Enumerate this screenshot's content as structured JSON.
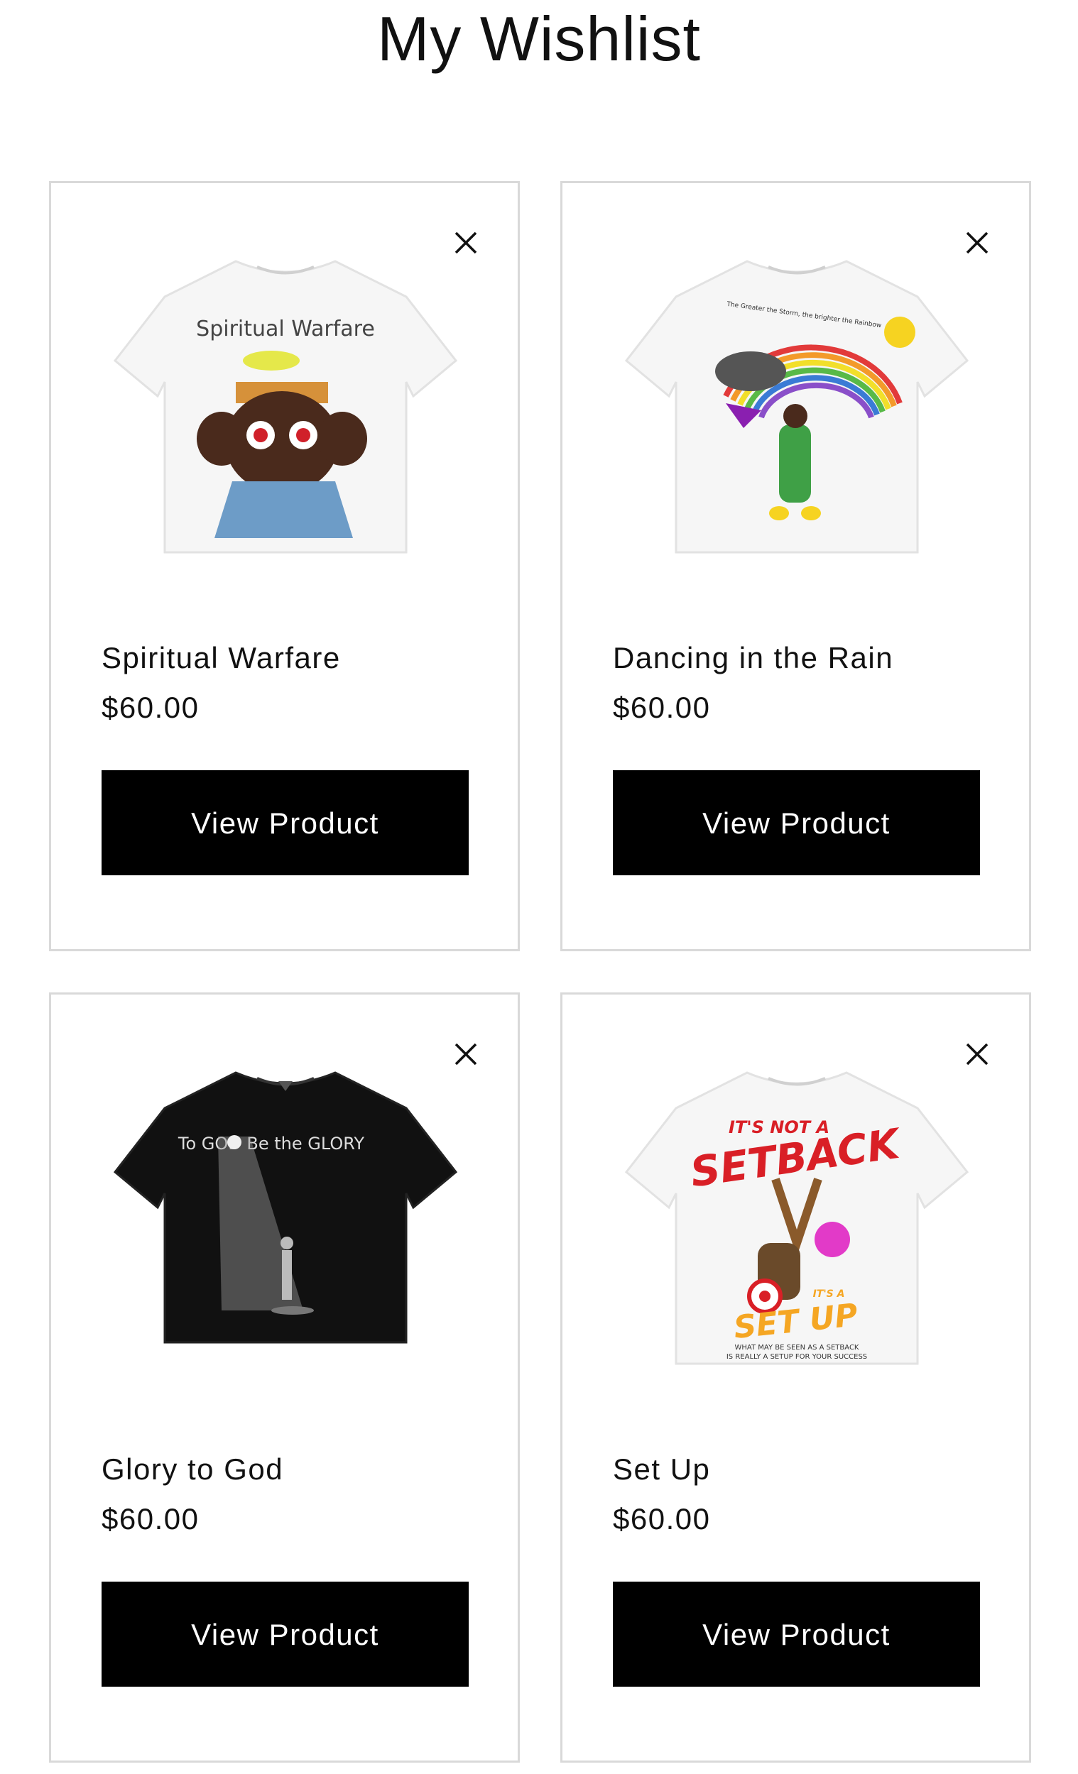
{
  "page": {
    "title": "My Wishlist"
  },
  "colors": {
    "button_bg": "#000000",
    "button_text": "#ffffff",
    "card_border": "#d9d9d9"
  },
  "items": [
    {
      "name": "Spiritual Warfare",
      "price": "$60.00",
      "button_label": "View Product",
      "shirt_color": "white",
      "print_text": "Spiritual Warfare",
      "icons": [
        "close-icon"
      ]
    },
    {
      "name": "Dancing in the Rain",
      "price": "$60.00",
      "button_label": "View Product",
      "shirt_color": "white",
      "print_text": "The Greater the Storm, the brighter the Rainbow",
      "icons": [
        "close-icon"
      ]
    },
    {
      "name": "Glory to God",
      "price": "$60.00",
      "button_label": "View Product",
      "shirt_color": "black",
      "print_text": "To GOD Be the GLORY",
      "icons": [
        "close-icon"
      ]
    },
    {
      "name": "Set Up",
      "price": "$60.00",
      "button_label": "View Product",
      "shirt_color": "white",
      "print_text": {
        "top": "IT'S NOT A",
        "main": "SETBACK",
        "its_a": "IT'S A",
        "bottom": "SET UP",
        "caption_1": "WHAT MAY BE SEEN AS A SETBACK",
        "caption_2": "IS REALLY A SETUP FOR YOUR SUCCESS"
      },
      "icons": [
        "close-icon"
      ]
    }
  ]
}
